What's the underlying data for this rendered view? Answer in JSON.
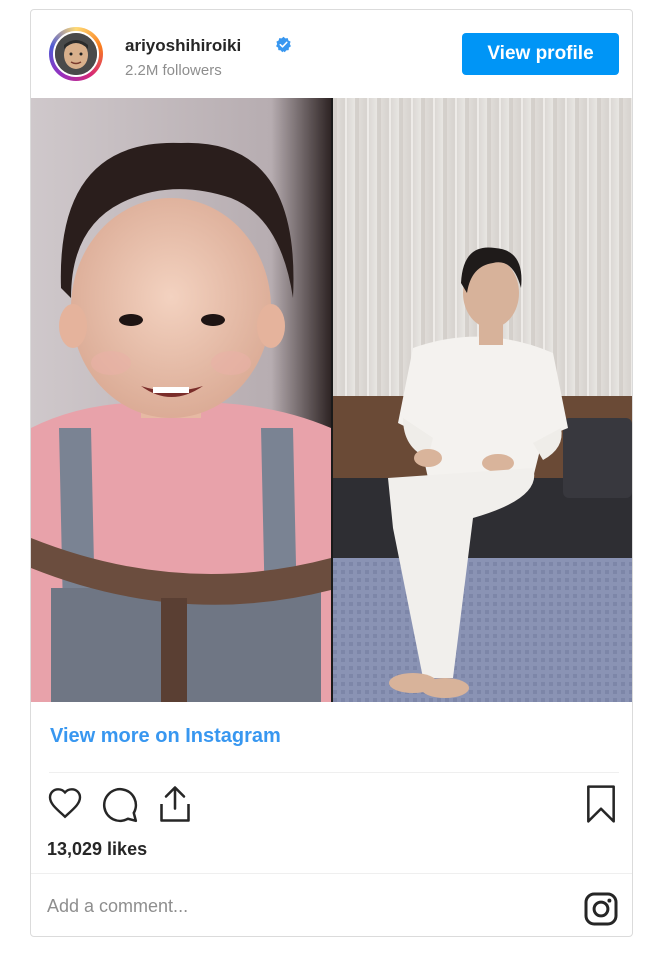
{
  "post": {
    "username": "ariyoshihiroiki",
    "verified": true,
    "followers": "2.2M followers",
    "view_profile_label": "View profile",
    "view_more_label": "View more on Instagram",
    "likes": "13,029 likes",
    "comment_placeholder": "Add a comment..."
  },
  "icons": {
    "like": "heart-outline-icon",
    "comment": "speech-bubble-icon",
    "share": "share-upload-icon",
    "save": "bookmark-outline-icon",
    "instagram": "instagram-logo-icon"
  },
  "colors": {
    "accent": "#0095f6",
    "link": "#3897f0",
    "muted": "#8e8e8e",
    "text": "#262626"
  }
}
